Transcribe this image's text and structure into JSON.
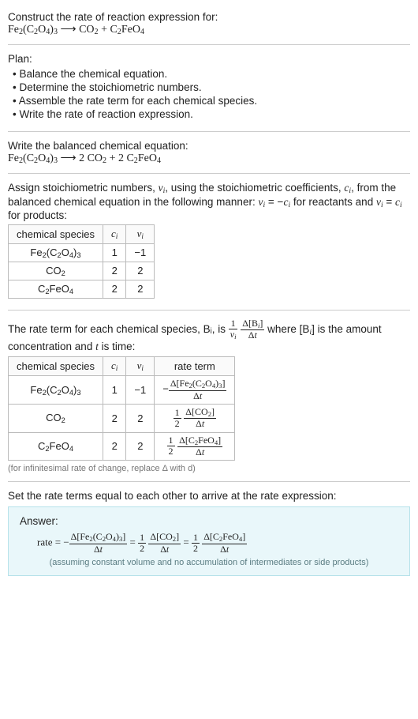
{
  "title": "Construct the rate of reaction expression for:",
  "equation_unbalanced": "Fe₂(C₂O₄)₃ ⟶ CO₂ + C₂FeO₄",
  "plan_title": "Plan:",
  "plan_items": [
    "Balance the chemical equation.",
    "Determine the stoichiometric numbers.",
    "Assemble the rate term for each chemical species.",
    "Write the rate of reaction expression."
  ],
  "balanced_title": "Write the balanced chemical equation:",
  "equation_balanced": "Fe₂(C₂O₄)₃ ⟶ 2 CO₂ + 2 C₂FeO₄",
  "stoich_text1": "Assign stoichiometric numbers, νᵢ, using the stoichiometric coefficients, cᵢ, from the balanced chemical equation in the following manner: νᵢ = −cᵢ for reactants and νᵢ = cᵢ for products:",
  "table1": {
    "headers": [
      "chemical species",
      "cᵢ",
      "νᵢ"
    ],
    "rows": [
      [
        "Fe₂(C₂O₄)₃",
        "1",
        "−1"
      ],
      [
        "CO₂",
        "2",
        "2"
      ],
      [
        "C₂FeO₄",
        "2",
        "2"
      ]
    ]
  },
  "rate_term_text1": "The rate term for each chemical species, Bᵢ, is",
  "rate_term_text2": "where [Bᵢ] is the amount concentration and t is time:",
  "table2": {
    "headers": [
      "chemical species",
      "cᵢ",
      "νᵢ",
      "rate term"
    ],
    "rows": [
      {
        "sp": "Fe₂(C₂O₄)₃",
        "c": "1",
        "v": "−1",
        "rt": {
          "neg": true,
          "half": false,
          "lbl": "Δ[Fe₂(C₂O₄)₃]"
        }
      },
      {
        "sp": "CO₂",
        "c": "2",
        "v": "2",
        "rt": {
          "neg": false,
          "half": true,
          "lbl": "Δ[CO₂]"
        }
      },
      {
        "sp": "C₂FeO₄",
        "c": "2",
        "v": "2",
        "rt": {
          "neg": false,
          "half": true,
          "lbl": "Δ[C₂FeO₄]"
        }
      }
    ]
  },
  "footnote": "(for infinitesimal rate of change, replace Δ with d)",
  "set_equal": "Set the rate terms equal to each other to arrive at the rate expression:",
  "answer_title": "Answer:",
  "answer_note": "(assuming constant volume and no accumulation of intermediates or side products)",
  "chart_data": {
    "type": "table",
    "title": "Stoichiometric numbers and rate terms for Fe2(C2O4)3 → 2 CO2 + 2 C2FeO4",
    "species": [
      "Fe2(C2O4)3",
      "CO2",
      "C2FeO4"
    ],
    "c_i": [
      1,
      2,
      2
    ],
    "nu_i": [
      -1,
      2,
      2
    ],
    "rate_terms": [
      "-Δ[Fe2(C2O4)3]/Δt",
      "(1/2) Δ[CO2]/Δt",
      "(1/2) Δ[C2FeO4]/Δt"
    ],
    "rate_expression": "rate = -Δ[Fe2(C2O4)3]/Δt = (1/2) Δ[CO2]/Δt = (1/2) Δ[C2FeO4]/Δt"
  }
}
